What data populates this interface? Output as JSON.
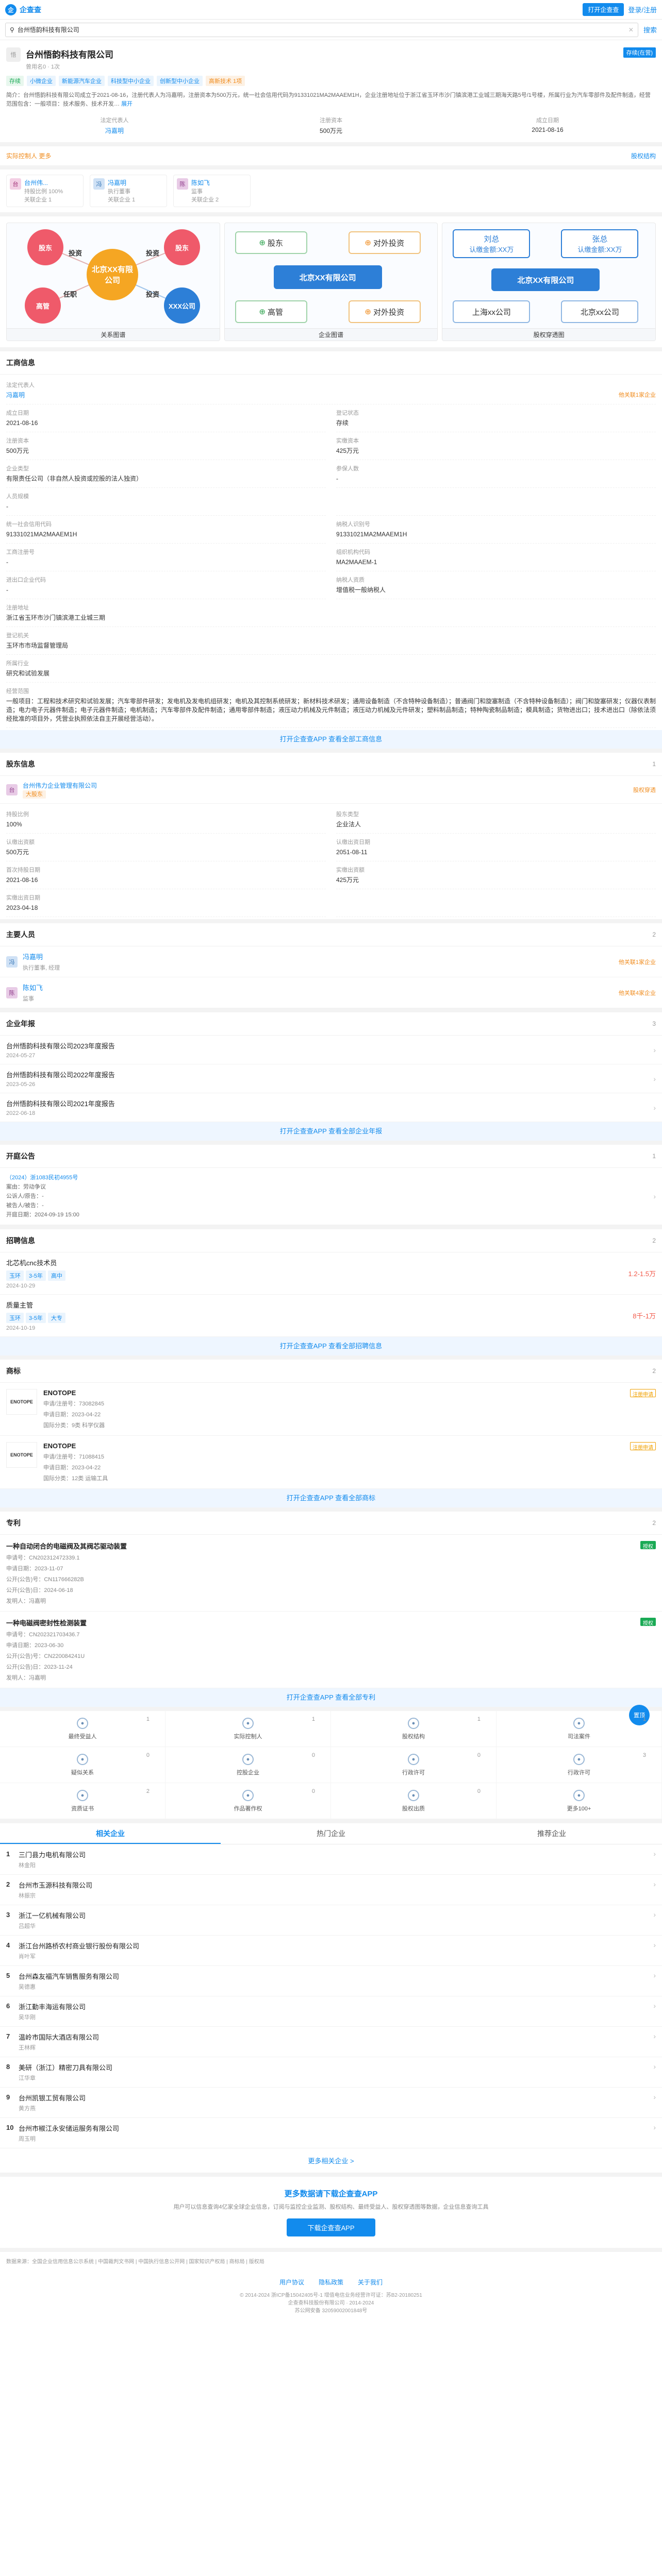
{
  "topbar": {
    "brand": "企查查",
    "open_app": "打开企查查",
    "login": "登录/注册"
  },
  "search": {
    "value": "台州悟韵科技有限公司",
    "button": "搜索"
  },
  "company": {
    "name": "台州悟韵科技有限公司",
    "status_badge": "存续(在营)",
    "sub": "曾用名0 · 1次",
    "tags": [
      "存续",
      "小微企业",
      "新能源汽车企业",
      "科技型中小企业",
      "创新型中小企业",
      "高新技术 1项"
    ],
    "intro": "简介：台州悟韵科技有限公司成立于2021-08-16，注册代表人为冯嘉明，注册资本为500万元，统一社会信用代码为91331021MA2MAAEM1H，企业注册地址位于浙江省玉环市沙门镇滨港工业城三期海天路5号/1号楼，所属行业为汽车零部件及配件制造，经营范围包含：一般项目：技术服务、技术开发…",
    "intro_more": "展开",
    "legal_rep_label": "法定代表人",
    "legal_rep": "冯嘉明",
    "capital_label": "注册资本",
    "capital": "500万元",
    "date_label": "成立日期",
    "date": "2021-08-16"
  },
  "control": {
    "left": "实际控制人  更多",
    "right": "股权结构"
  },
  "holders": [
    {
      "avatar": "台",
      "name": "台州伟...",
      "role": "持股比例 100%",
      "sub": "关联企业 1"
    },
    {
      "avatar": "冯",
      "name": "冯嘉明",
      "role": "执行董事",
      "sub": "关联企业 1"
    },
    {
      "avatar": "陈",
      "name": "陈如飞",
      "role": "监事",
      "sub": "关联企业 2"
    }
  ],
  "graphs": {
    "g1": {
      "center": "北京XX有限公司",
      "n1": "股东",
      "n2": "股东",
      "n3": "高管",
      "n4": "XXX公司",
      "e1": "投资",
      "e2": "投资",
      "e3": "任职",
      "e4": "投资",
      "cap": "关系图谱"
    },
    "g2": {
      "b1": "股东",
      "b2": "对外投资",
      "center": "北京XX有限公司",
      "b3": "高管",
      "b4": "对外投资",
      "cap": "企业图谱"
    },
    "g3": {
      "p1": "刘总",
      "p1s": "认缴金额:XX万",
      "p2": "张总",
      "p2s": "认缴金额:XX万",
      "center": "北京XX有限公司",
      "c1": "上海xx公司",
      "c2": "北京xx公司",
      "cap": "股权穿透图"
    }
  },
  "biz": {
    "title": "工商信息",
    "legal_label": "法定代表人",
    "legal": "冯嘉明",
    "legal_link": "他关联1家企业",
    "f": [
      {
        "k": "成立日期",
        "v": "2021-08-16"
      },
      {
        "k": "登记状态",
        "v": "存续"
      },
      {
        "k": "注册资本",
        "v": "500万元"
      },
      {
        "k": "实缴资本",
        "v": "425万元"
      },
      {
        "k": "企业类型",
        "v": "有限责任公司（非自然人投资或控股的法人独资）"
      },
      {
        "k": "参保人数",
        "v": "-"
      },
      {
        "k": "人员规模",
        "v": "-"
      },
      {
        "k": "",
        "v": ""
      },
      {
        "k": "统一社会信用代码",
        "v": "91331021MA2MAAEM1H"
      },
      {
        "k": "纳税人识别号",
        "v": "91331021MA2MAAEM1H"
      },
      {
        "k": "工商注册号",
        "v": "-"
      },
      {
        "k": "组织机构代码",
        "v": "MA2MAAEM-1"
      },
      {
        "k": "进出口企业代码",
        "v": "-"
      },
      {
        "k": "纳税人资质",
        "v": "增值税一般纳税人"
      }
    ],
    "addr_label": "注册地址",
    "addr": "浙江省玉环市沙门镇滨港工业城三期",
    "region_label": "登记机关",
    "region": "玉环市市场监督管理局",
    "industry_label": "所属行业",
    "industry": "研究和试验发展",
    "scope_label": "经营范围",
    "scope": "一般项目：工程和技术研究和试验发展；汽车零部件研发；发电机及发电机组研发；电机及其控制系统研发；新材料技术研发；通用设备制造（不含特种设备制造）；普通阀门和旋塞制造（不含特种设备制造）；阀门和旋塞研发；仪器仪表制造；电力电子元器件制造；电子元器件制造；电机制造；汽车零部件及配件制造；通用零部件制造；液压动力机械及元件制造；液压动力机械及元件研发；塑料制品制造；特种陶瓷制品制造；模具制造；货物进出口；技术进出口（除依法须经批准的项目外，凭营业执照依法自主开展经营活动）。",
    "more": "打开企查查APP 查看全部工商信息"
  },
  "share": {
    "title": "股东信息",
    "cnt": "1",
    "holder": "台州伟力企业管理有限公司",
    "holder_tag": "大股东",
    "link": "股权穿透",
    "f": [
      {
        "k": "持股比例",
        "v": "100%"
      },
      {
        "k": "股东类型",
        "v": "企业法人"
      },
      {
        "k": "认缴出资额",
        "v": "500万元"
      },
      {
        "k": "认缴出资日期",
        "v": "2051-08-11"
      },
      {
        "k": "首次持股日期",
        "v": "2021-08-16"
      },
      {
        "k": "实缴出资额",
        "v": "425万元"
      },
      {
        "k": "实缴出资日期",
        "v": "2023-04-18"
      },
      {
        "k": "",
        "v": ""
      }
    ]
  },
  "people": {
    "title": "主要人员",
    "cnt": "2",
    "list": [
      {
        "av": "冯",
        "name": "冯嘉明",
        "role": "执行董事, 经理",
        "rel": "他关联1家企业"
      },
      {
        "av": "陈",
        "name": "陈如飞",
        "role": "监事",
        "rel": "他关联4家企业"
      }
    ]
  },
  "reports": {
    "title": "企业年报",
    "cnt": "3",
    "list": [
      {
        "t": "台州悟韵科技有限公司2023年度报告",
        "s": "2024-05-27"
      },
      {
        "t": "台州悟韵科技有限公司2022年度报告",
        "s": "2023-05-26"
      },
      {
        "t": "台州悟韵科技有限公司2021年度报告",
        "s": "2022-06-18"
      }
    ],
    "more": "打开企查查APP 查看全部企业年报"
  },
  "notice": {
    "title": "开庭公告",
    "cnt": "1",
    "case": "（2024）浙1083民初4955号",
    "f": [
      {
        "k": "案由：",
        "v": "劳动争议"
      },
      {
        "k": "公诉人/原告：",
        "v": "-"
      },
      {
        "k": "被告人/被告：",
        "v": "-"
      },
      {
        "k": "开庭日期：",
        "v": "2024-09-19 15:00"
      }
    ]
  },
  "jobs": {
    "title": "招聘信息",
    "cnt": "2",
    "list": [
      {
        "t": "北芯机cnc技术员",
        "sal": "1.2-1.5万",
        "tags": [
          "玉环",
          "3-5年",
          "高中"
        ],
        "d": "2024-10-29"
      },
      {
        "t": "质量主管",
        "sal": "8千-1万",
        "tags": [
          "玉环",
          "3-5年",
          "大专"
        ],
        "d": "2024-10-19"
      }
    ],
    "more": "打开企查查APP 查看全部招聘信息"
  },
  "marks": {
    "title": "商标",
    "cnt": "2",
    "list": [
      {
        "logo": "ENOTOPE",
        "t": "ENOTOPE",
        "badge": "注册申请",
        "a": "申请/注册号：73082845",
        "b": "申请日期：2023-04-22",
        "c": "国际分类：9类 科学仪器"
      },
      {
        "logo": "ENOTOPE",
        "t": "ENOTOPE",
        "badge": "注册申请",
        "a": "申请/注册号：71088415",
        "b": "申请日期：2023-04-22",
        "c": "国际分类：12类 运输工具"
      }
    ],
    "more": "打开企查查APP 查看全部商标"
  },
  "patents": {
    "title": "专利",
    "cnt": "2",
    "list": [
      {
        "t": "一种自动闭合的电磁阀及其阀芯驱动装置",
        "badge": "授权",
        "a": "申请号：CN202312472339.1",
        "b": "申请日期：2023-11-07",
        "c": "公开(公告)号：CN117666282B",
        "d": "公开(公告)日：2024-06-18",
        "e": "发明人：冯嘉明"
      },
      {
        "t": "一种电磁阀密封性检测装置",
        "badge": "授权",
        "a": "申请号：CN202321703436.7",
        "b": "申请日期：2023-06-30",
        "c": "公开(公告)号：CN220084241U",
        "d": "公开(公告)日：2023-11-24",
        "e": "发明人：冯嘉明"
      }
    ],
    "more": "打开企查查APP 查看全部专利",
    "float": "置顶"
  },
  "icons": [
    {
      "label": "最终受益人",
      "n": "1"
    },
    {
      "label": "实际控制人",
      "n": "1"
    },
    {
      "label": "股权结构",
      "n": "1"
    },
    {
      "label": "司法案件",
      "n": "1"
    },
    {
      "label": "疑似关系",
      "n": "0"
    },
    {
      "label": "控股企业",
      "n": "0"
    },
    {
      "label": "行政许可",
      "n": "0"
    },
    {
      "label": "行政许可",
      "n": "3"
    },
    {
      "label": "资质证书",
      "n": "2"
    },
    {
      "label": "作品著作权",
      "n": "0"
    },
    {
      "label": "股权出质",
      "n": "0"
    },
    {
      "label": "更多100+",
      "n": ""
    }
  ],
  "related": {
    "tabs": [
      "相关企业",
      "热门企业",
      "推荐企业"
    ],
    "list": [
      {
        "t": "三门县力电机有限公司",
        "s": "林金阳"
      },
      {
        "t": "台州市玉源科技有限公司",
        "s": "林振宗"
      },
      {
        "t": "浙江一亿机械有限公司",
        "s": "吕超华"
      },
      {
        "t": "浙江台州路桥农村商业银行股份有限公司",
        "s": "肖叶军"
      },
      {
        "t": "台州森友福汽车销售服务有限公司",
        "s": "吴德惠"
      },
      {
        "t": "浙江勤丰海运有限公司",
        "s": "吴华刚"
      },
      {
        "t": "温岭市国际大酒店有限公司",
        "s": "王林辉"
      },
      {
        "t": "美研（浙江）精密刀具有限公司",
        "s": "江华章"
      },
      {
        "t": "台州凯银工贸有限公司",
        "s": "黄方燕"
      },
      {
        "t": "台州市椒江永安储运服务有限公司",
        "s": "周玉明"
      }
    ],
    "more": "更多相关企业 >"
  },
  "promo": {
    "h": "更多数据请下载企查查APP",
    "p": "用户可以信息查询4亿家全球企业信息，订阅与监控企业监测、股权结构、最终受益人、股权穿透图等数据，企业信息查询工具",
    "btn": "下载企查查APP"
  },
  "footer": {
    "hot": "数据来源：全国企业信用信息公示系统 | 中国裁判文书网 | 中国执行信息公开网 | 国家知识产权局 | 商标局 | 版权局",
    "links": [
      "用户协议",
      "隐私政策",
      "关于我们"
    ],
    "copy1": "© 2014-2024 浙ICP备15042405号-1 增值电信业务经营许可证：苏B2-20180251",
    "copy2": "企查查科技股份有限公司 · 2014-2024",
    "copy3": "苏公网安备 32059002001848号"
  }
}
